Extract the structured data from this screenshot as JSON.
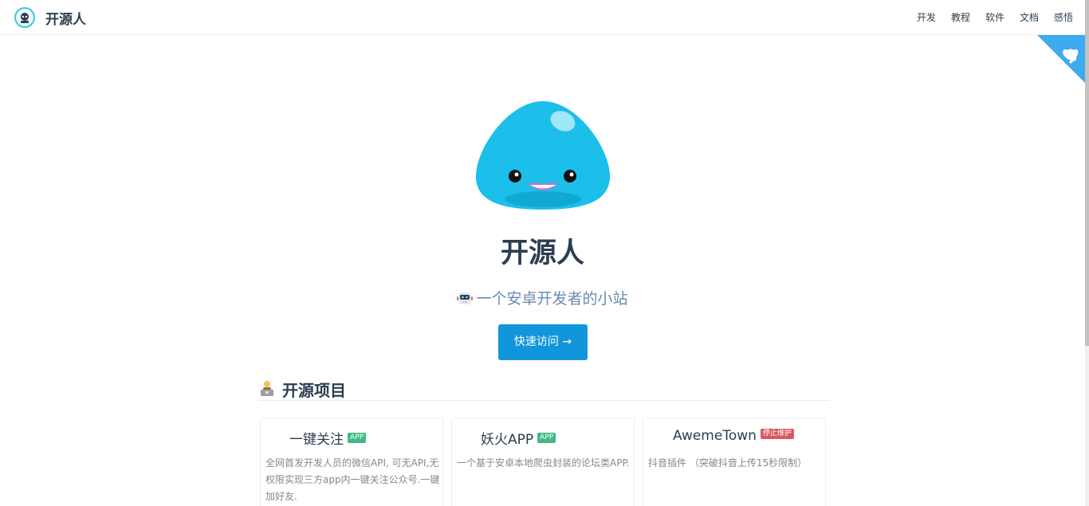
{
  "header": {
    "site_name": "开源人",
    "nav": [
      "开发",
      "教程",
      "软件",
      "文档",
      "感悟"
    ]
  },
  "hero": {
    "title": "开源人",
    "description": "一个安卓开发者的小站",
    "action": "快速访问 →"
  },
  "projects": {
    "title": "开源项目",
    "cards": [
      {
        "title": "一键关注",
        "badge": "APP",
        "badge_color": "#42b983",
        "desc": "全网首发开发人员的微信API, 可无API,无权限实现三方app内一键关注公众号.一键加好友."
      },
      {
        "title": "妖火APP",
        "badge": "APP",
        "badge_color": "#42b983",
        "desc": "一个基于安卓本地爬虫封装的论坛类APP."
      },
      {
        "title": "AwemeTown",
        "badge": "停止维护",
        "badge_color": "#da5961",
        "desc": "抖音插件 （突破抖音上传15秒限制）"
      }
    ]
  },
  "colors": {
    "accent": "#1296db",
    "corner": "#3eaaf0",
    "mascot": "#1bbfea"
  }
}
